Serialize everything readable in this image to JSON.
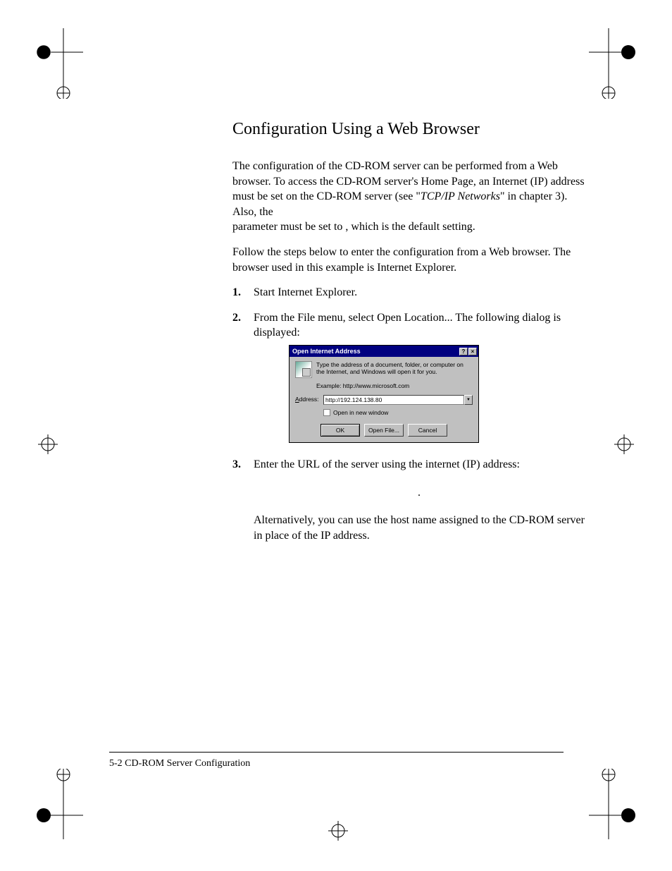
{
  "heading": "Configuration Using a Web Browser",
  "para1a": "The configuration of the CD-ROM server can be performed from a Web browser. To access the CD-ROM server's Home Page, an Internet (IP) address must be set on the CD-ROM server (see \"",
  "para1b_italic": "TCP/IP Networks",
  "para1c": "\" in chapter  3). Also, the",
  "para1d": "parameter must be set to      , which is the default setting.",
  "para2": "Follow the steps below to enter the configuration from a Web browser. The browser used in this example is Internet Explorer.",
  "steps": {
    "s1_num": "1.",
    "s1": "Start Internet Explorer.",
    "s2_num": "2.",
    "s2": "From the File menu, select Open Location... The following dialog is displayed:",
    "s3_num": "3.",
    "s3": "Enter the URL of the server using the internet (IP) address:",
    "s3_dot": ".",
    "s3_alt": "Alternatively, you can use the host name assigned to the CD-ROM server in place of the IP address."
  },
  "dialog": {
    "title": "Open Internet Address",
    "help": "?",
    "close": "×",
    "desc": "Type the address of a document, folder, or computer on the Internet, and Windows will open it for you.",
    "example": "Example: http://www.microsoft.com",
    "address_label_u": "A",
    "address_label": "ddress:",
    "address_value": "http://192.124.138.80",
    "dropdown": "▼",
    "new_window_pre": "Open in ",
    "new_window_u": "n",
    "new_window_post": "ew window",
    "ok": "OK",
    "open_file_pre": "Open ",
    "open_file_u": "F",
    "open_file_post": "ile...",
    "cancel": "Cancel"
  },
  "footer": "5-2 CD-ROM Server Configuration"
}
